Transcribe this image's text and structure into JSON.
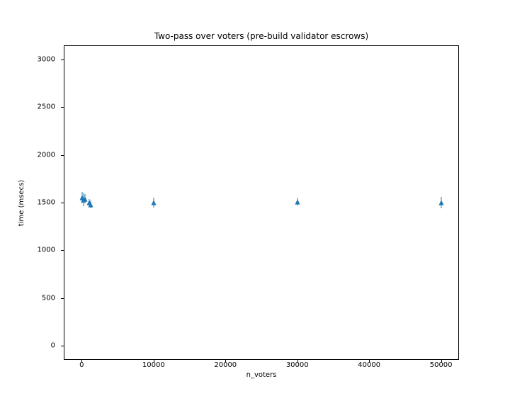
{
  "chart_data": {
    "type": "scatter",
    "title": "Two-pass over voters (pre-build validator escrows)",
    "xlabel": "n_voters",
    "ylabel": "time (msecs)",
    "xlim": [
      -2500,
      52500
    ],
    "ylim": [
      -150,
      3150
    ],
    "xticks": [
      0,
      10000,
      20000,
      30000,
      40000,
      50000
    ],
    "yticks": [
      0,
      500,
      1000,
      1500,
      2000,
      2500,
      3000
    ],
    "marker": "triangle-up",
    "color": "#1f77b4",
    "series": [
      {
        "name": "time",
        "points": [
          {
            "x": 100,
            "y": 1550,
            "yerr": 60
          },
          {
            "x": 300,
            "y": 1530,
            "yerr": 70
          },
          {
            "x": 500,
            "y": 1540,
            "yerr": 50
          },
          {
            "x": 1000,
            "y": 1500,
            "yerr": 40
          },
          {
            "x": 1200,
            "y": 1480,
            "yerr": 40
          },
          {
            "x": 10000,
            "y": 1500,
            "yerr": 50
          },
          {
            "x": 30000,
            "y": 1510,
            "yerr": 40
          },
          {
            "x": 50000,
            "y": 1500,
            "yerr": 60
          }
        ]
      }
    ]
  }
}
